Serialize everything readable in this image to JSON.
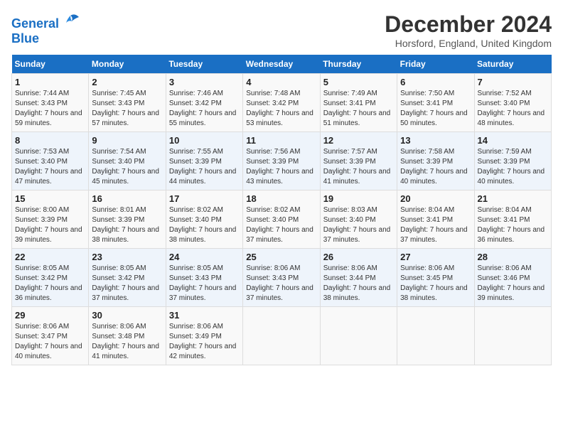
{
  "header": {
    "logo_line1": "General",
    "logo_line2": "Blue",
    "main_title": "December 2024",
    "subtitle": "Horsford, England, United Kingdom"
  },
  "columns": [
    "Sunday",
    "Monday",
    "Tuesday",
    "Wednesday",
    "Thursday",
    "Friday",
    "Saturday"
  ],
  "weeks": [
    [
      {
        "day": "1",
        "sunrise": "Sunrise: 7:44 AM",
        "sunset": "Sunset: 3:43 PM",
        "daylight": "Daylight: 7 hours and 59 minutes."
      },
      {
        "day": "2",
        "sunrise": "Sunrise: 7:45 AM",
        "sunset": "Sunset: 3:43 PM",
        "daylight": "Daylight: 7 hours and 57 minutes."
      },
      {
        "day": "3",
        "sunrise": "Sunrise: 7:46 AM",
        "sunset": "Sunset: 3:42 PM",
        "daylight": "Daylight: 7 hours and 55 minutes."
      },
      {
        "day": "4",
        "sunrise": "Sunrise: 7:48 AM",
        "sunset": "Sunset: 3:42 PM",
        "daylight": "Daylight: 7 hours and 53 minutes."
      },
      {
        "day": "5",
        "sunrise": "Sunrise: 7:49 AM",
        "sunset": "Sunset: 3:41 PM",
        "daylight": "Daylight: 7 hours and 51 minutes."
      },
      {
        "day": "6",
        "sunrise": "Sunrise: 7:50 AM",
        "sunset": "Sunset: 3:41 PM",
        "daylight": "Daylight: 7 hours and 50 minutes."
      },
      {
        "day": "7",
        "sunrise": "Sunrise: 7:52 AM",
        "sunset": "Sunset: 3:40 PM",
        "daylight": "Daylight: 7 hours and 48 minutes."
      }
    ],
    [
      {
        "day": "8",
        "sunrise": "Sunrise: 7:53 AM",
        "sunset": "Sunset: 3:40 PM",
        "daylight": "Daylight: 7 hours and 47 minutes."
      },
      {
        "day": "9",
        "sunrise": "Sunrise: 7:54 AM",
        "sunset": "Sunset: 3:40 PM",
        "daylight": "Daylight: 7 hours and 45 minutes."
      },
      {
        "day": "10",
        "sunrise": "Sunrise: 7:55 AM",
        "sunset": "Sunset: 3:39 PM",
        "daylight": "Daylight: 7 hours and 44 minutes."
      },
      {
        "day": "11",
        "sunrise": "Sunrise: 7:56 AM",
        "sunset": "Sunset: 3:39 PM",
        "daylight": "Daylight: 7 hours and 43 minutes."
      },
      {
        "day": "12",
        "sunrise": "Sunrise: 7:57 AM",
        "sunset": "Sunset: 3:39 PM",
        "daylight": "Daylight: 7 hours and 41 minutes."
      },
      {
        "day": "13",
        "sunrise": "Sunrise: 7:58 AM",
        "sunset": "Sunset: 3:39 PM",
        "daylight": "Daylight: 7 hours and 40 minutes."
      },
      {
        "day": "14",
        "sunrise": "Sunrise: 7:59 AM",
        "sunset": "Sunset: 3:39 PM",
        "daylight": "Daylight: 7 hours and 40 minutes."
      }
    ],
    [
      {
        "day": "15",
        "sunrise": "Sunrise: 8:00 AM",
        "sunset": "Sunset: 3:39 PM",
        "daylight": "Daylight: 7 hours and 39 minutes."
      },
      {
        "day": "16",
        "sunrise": "Sunrise: 8:01 AM",
        "sunset": "Sunset: 3:39 PM",
        "daylight": "Daylight: 7 hours and 38 minutes."
      },
      {
        "day": "17",
        "sunrise": "Sunrise: 8:02 AM",
        "sunset": "Sunset: 3:40 PM",
        "daylight": "Daylight: 7 hours and 38 minutes."
      },
      {
        "day": "18",
        "sunrise": "Sunrise: 8:02 AM",
        "sunset": "Sunset: 3:40 PM",
        "daylight": "Daylight: 7 hours and 37 minutes."
      },
      {
        "day": "19",
        "sunrise": "Sunrise: 8:03 AM",
        "sunset": "Sunset: 3:40 PM",
        "daylight": "Daylight: 7 hours and 37 minutes."
      },
      {
        "day": "20",
        "sunrise": "Sunrise: 8:04 AM",
        "sunset": "Sunset: 3:41 PM",
        "daylight": "Daylight: 7 hours and 37 minutes."
      },
      {
        "day": "21",
        "sunrise": "Sunrise: 8:04 AM",
        "sunset": "Sunset: 3:41 PM",
        "daylight": "Daylight: 7 hours and 36 minutes."
      }
    ],
    [
      {
        "day": "22",
        "sunrise": "Sunrise: 8:05 AM",
        "sunset": "Sunset: 3:42 PM",
        "daylight": "Daylight: 7 hours and 36 minutes."
      },
      {
        "day": "23",
        "sunrise": "Sunrise: 8:05 AM",
        "sunset": "Sunset: 3:42 PM",
        "daylight": "Daylight: 7 hours and 37 minutes."
      },
      {
        "day": "24",
        "sunrise": "Sunrise: 8:05 AM",
        "sunset": "Sunset: 3:43 PM",
        "daylight": "Daylight: 7 hours and 37 minutes."
      },
      {
        "day": "25",
        "sunrise": "Sunrise: 8:06 AM",
        "sunset": "Sunset: 3:43 PM",
        "daylight": "Daylight: 7 hours and 37 minutes."
      },
      {
        "day": "26",
        "sunrise": "Sunrise: 8:06 AM",
        "sunset": "Sunset: 3:44 PM",
        "daylight": "Daylight: 7 hours and 38 minutes."
      },
      {
        "day": "27",
        "sunrise": "Sunrise: 8:06 AM",
        "sunset": "Sunset: 3:45 PM",
        "daylight": "Daylight: 7 hours and 38 minutes."
      },
      {
        "day": "28",
        "sunrise": "Sunrise: 8:06 AM",
        "sunset": "Sunset: 3:46 PM",
        "daylight": "Daylight: 7 hours and 39 minutes."
      }
    ],
    [
      {
        "day": "29",
        "sunrise": "Sunrise: 8:06 AM",
        "sunset": "Sunset: 3:47 PM",
        "daylight": "Daylight: 7 hours and 40 minutes."
      },
      {
        "day": "30",
        "sunrise": "Sunrise: 8:06 AM",
        "sunset": "Sunset: 3:48 PM",
        "daylight": "Daylight: 7 hours and 41 minutes."
      },
      {
        "day": "31",
        "sunrise": "Sunrise: 8:06 AM",
        "sunset": "Sunset: 3:49 PM",
        "daylight": "Daylight: 7 hours and 42 minutes."
      },
      null,
      null,
      null,
      null
    ]
  ]
}
